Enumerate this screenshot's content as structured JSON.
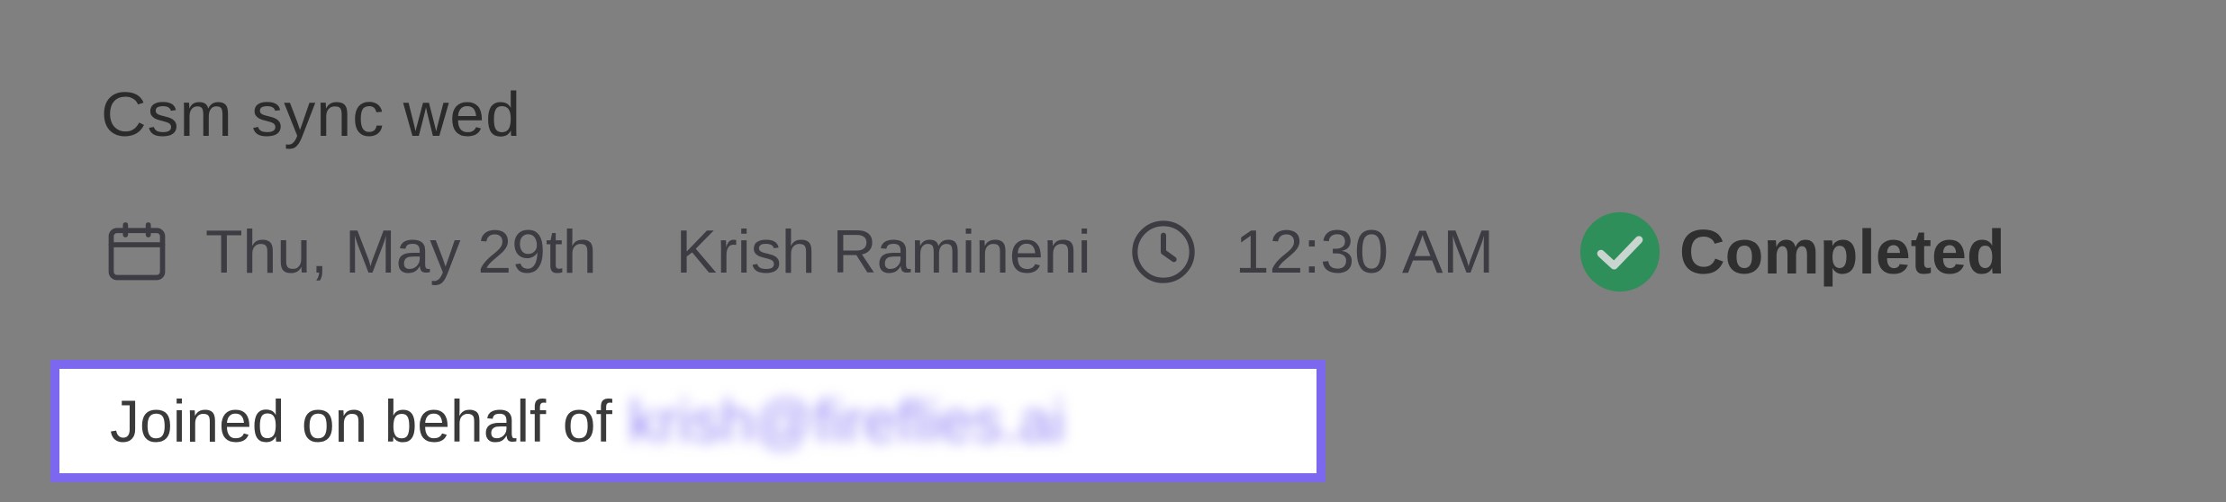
{
  "meeting": {
    "title": "Csm sync wed",
    "date": "Thu, May 29th",
    "owner": "Krish Ramineni",
    "time": "12:30 AM",
    "status": "Completed",
    "joined_label": "Joined on behalf of",
    "joined_email": "krish@fireflies.ai"
  },
  "icons": {
    "date": "calendar-icon",
    "time": "clock-icon",
    "status": "check-circle-icon"
  },
  "colors": {
    "overlay": "#808080",
    "status_green": "#2f8f5a",
    "highlight_border": "#7b68ee",
    "email_link": "#9a8ff5"
  }
}
